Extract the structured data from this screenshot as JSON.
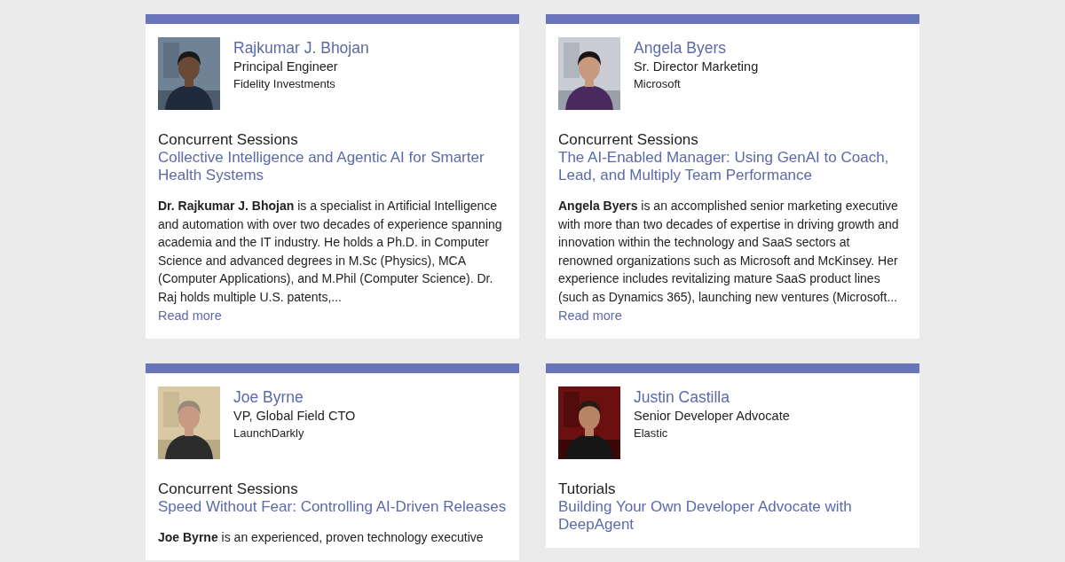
{
  "speakers": [
    {
      "name": "Rajkumar J. Bhojan",
      "title": "Principal Engineer",
      "company": "Fidelity Investments",
      "session_type": "Concurrent Sessions",
      "session_title": "Collective Intelligence and Agentic AI for Smarter Health Systems",
      "bio": "**Dr. Rajkumar J. Bhojan** is a specialist in Artificial Intelligence and automation with over two decades of experience spanning academia and the IT industry. He holds a Ph.D. in Computer Science and advanced degrees in M.Sc (Physics), MCA (Computer Applications), and M.Phil (Computer Science). Dr. Raj holds multiple U.S. patents,...",
      "read_more": "Read more"
    },
    {
      "name": "Angela Byers",
      "title": "Sr. Director Marketing",
      "company": "Microsoft",
      "session_type": "Concurrent Sessions",
      "session_title": "The AI-Enabled Manager: Using GenAI to Coach, Lead, and Multiply Team Performance",
      "bio": "**Angela Byers** is an accomplished senior marketing executive with more than two decades of expertise in driving growth and innovation within the technology and SaaS sectors at renowned organizations such as Microsoft and McKinsey. Her experience includes revitalizing mature SaaS product lines (such as Dynamics 365), launching new ventures (Microsoft...",
      "read_more": "Read more"
    },
    {
      "name": "Joe Byrne",
      "title": "VP, Global Field CTO",
      "company": "LaunchDarkly",
      "session_type": "Concurrent Sessions",
      "session_title": "Speed Without Fear: Controlling AI-Driven Releases",
      "bio": "**Joe Byrne** is an experienced, proven technology executive"
    },
    {
      "name": "Justin Castilla",
      "title": "Senior Developer Advocate",
      "company": "Elastic",
      "session_type": "Tutorials",
      "session_title": "Building Your Own Developer Advocate with DeepAgent"
    }
  ]
}
